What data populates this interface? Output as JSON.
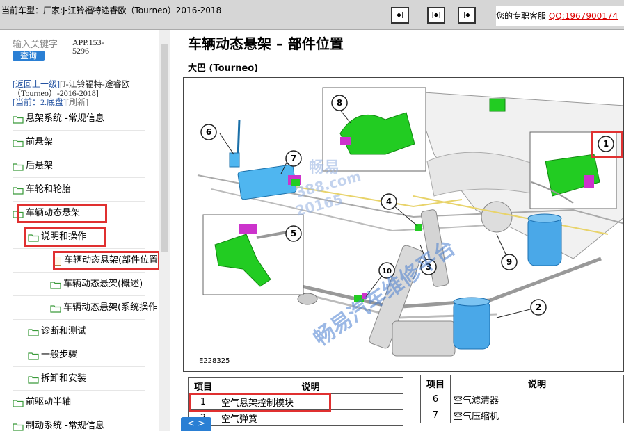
{
  "topbar": {
    "current_model_label": "当前车型：",
    "current_model_value": "厂家:J-江铃福特途睿欧（Tourneo）2016-2018",
    "nav_buttons": [
      "◆|",
      "|◆|",
      "|◆"
    ],
    "service_label": "您的专职客服",
    "service_qq": "QQ:1967900174"
  },
  "sidebar": {
    "search_placeholder": "输入关键字",
    "search_button": "查询",
    "app_code": "APP.153-5296",
    "back_link": "[返回上一级]",
    "back_target": "[J-江铃福特-途睿欧（Tourneo）-2016-2018]",
    "current_label": "[当前：",
    "current_value": "2.底盘]",
    "refresh": "[刷新]",
    "tree": [
      {
        "label": "悬架系统 -常规信息"
      },
      {
        "label": "前悬架"
      },
      {
        "label": "后悬架"
      },
      {
        "label": "车轮和轮胎"
      },
      {
        "label": "车辆动态悬架"
      },
      {
        "label": "说明和操作"
      },
      {
        "label": "车辆动态悬架(部件位置)"
      },
      {
        "label": "车辆动态悬架(概述)"
      },
      {
        "label": "车辆动态悬架(系统操作"
      },
      {
        "label": "诊断和测试"
      },
      {
        "label": "一般步骤"
      },
      {
        "label": "拆卸和安装"
      },
      {
        "label": "前驱动半轴"
      },
      {
        "label": "制动系统 -常规信息"
      }
    ]
  },
  "content": {
    "title": "车辆动态悬架 – 部件位置",
    "subtitle": "大巴 (Tourneo)",
    "figure_id": "E228325",
    "callouts": [
      "1",
      "2",
      "3",
      "4",
      "5",
      "6",
      "7",
      "8",
      "9",
      "10"
    ],
    "table_left": {
      "headers": [
        "项目",
        "说明"
      ],
      "rows": [
        {
          "num": "1",
          "desc": "空气悬架控制模块"
        },
        {
          "num": "2",
          "desc": "空气弹簧"
        }
      ]
    },
    "table_right": {
      "headers": [
        "项目",
        "说明"
      ],
      "rows": [
        {
          "num": "6",
          "desc": "空气滤清器"
        },
        {
          "num": "7",
          "desc": "空气压缩机"
        }
      ]
    },
    "page_nav": "< >"
  },
  "watermarks": {
    "diag": "畅易汽车维修平台",
    "mid1": "畅易",
    "mid2": "388.com",
    "mid3": "20165"
  },
  "colors": {
    "highlight_box": "#e03030",
    "button_blue": "#2a7fd4",
    "component_green": "#22cc22",
    "component_blue": "#33aaee",
    "component_magenta": "#cc33cc"
  }
}
